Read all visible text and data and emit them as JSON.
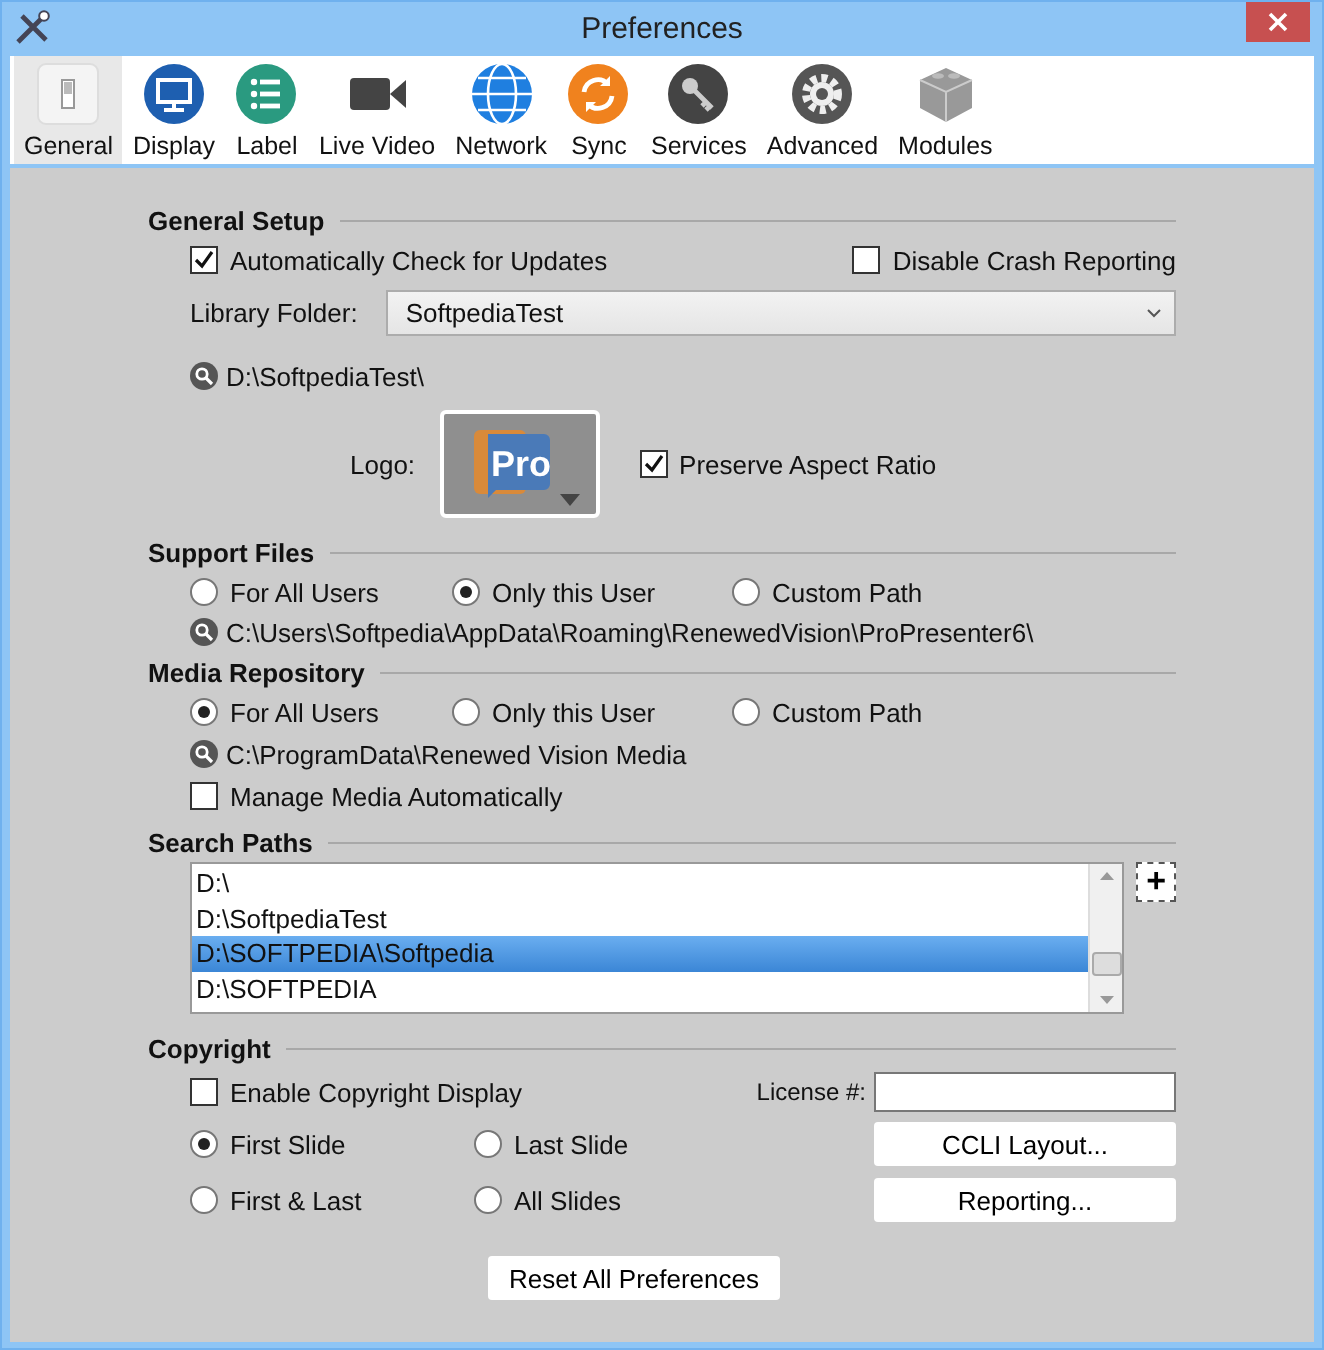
{
  "window": {
    "title": "Preferences"
  },
  "toolbar": [
    {
      "kind": "general",
      "label": "General",
      "selected": true
    },
    {
      "kind": "display",
      "label": "Display",
      "selected": false
    },
    {
      "kind": "label",
      "label": "Label",
      "selected": false
    },
    {
      "kind": "video",
      "label": "Live Video",
      "selected": false
    },
    {
      "kind": "network",
      "label": "Network",
      "selected": false
    },
    {
      "kind": "sync",
      "label": "Sync",
      "selected": false
    },
    {
      "kind": "services",
      "label": "Services",
      "selected": false
    },
    {
      "kind": "advanced",
      "label": "Advanced",
      "selected": false
    },
    {
      "kind": "modules",
      "label": "Modules",
      "selected": false
    }
  ],
  "general_setup": {
    "heading": "General Setup",
    "auto_check": {
      "label": "Automatically Check for Updates",
      "checked": true
    },
    "disable_crash": {
      "label": "Disable Crash Reporting",
      "checked": false
    },
    "library_label": "Library Folder:",
    "library_value": "SoftpediaTest",
    "library_path": "D:\\SoftpediaTest\\",
    "logo_label": "Logo:",
    "logo_text": "Pro",
    "preserve": {
      "label": "Preserve Aspect Ratio",
      "checked": true
    }
  },
  "support_files": {
    "heading": "Support Files",
    "options": [
      {
        "label": "For All Users",
        "selected": false
      },
      {
        "label": "Only this User",
        "selected": true
      },
      {
        "label": "Custom Path",
        "selected": false
      }
    ],
    "path": "C:\\Users\\Softpedia\\AppData\\Roaming\\RenewedVision\\ProPresenter6\\"
  },
  "media_repository": {
    "heading": "Media Repository",
    "options": [
      {
        "label": "For All Users",
        "selected": true
      },
      {
        "label": "Only this User",
        "selected": false
      },
      {
        "label": "Custom Path",
        "selected": false
      }
    ],
    "path": "C:\\ProgramData\\Renewed Vision Media",
    "manage": {
      "label": "Manage Media Automatically",
      "checked": false
    }
  },
  "search_paths": {
    "heading": "Search Paths",
    "items": [
      {
        "label": "D:\\",
        "selected": false
      },
      {
        "label": "D:\\SoftpediaTest",
        "selected": false
      },
      {
        "label": "D:\\SOFTPEDIA\\Softpedia",
        "selected": true
      },
      {
        "label": "D:\\SOFTPEDIA",
        "selected": false
      }
    ],
    "add_button": "+"
  },
  "copyright": {
    "heading": "Copyright",
    "enable": {
      "label": "Enable Copyright Display",
      "checked": false
    },
    "license_label": "License #:",
    "options": [
      {
        "label": "First Slide",
        "selected": true
      },
      {
        "label": "Last Slide",
        "selected": false
      },
      {
        "label": "First & Last",
        "selected": false
      },
      {
        "label": "All Slides",
        "selected": false
      }
    ],
    "buttons": [
      "CCLI Layout...",
      "Reporting..."
    ]
  },
  "reset_button": "Reset All Preferences"
}
